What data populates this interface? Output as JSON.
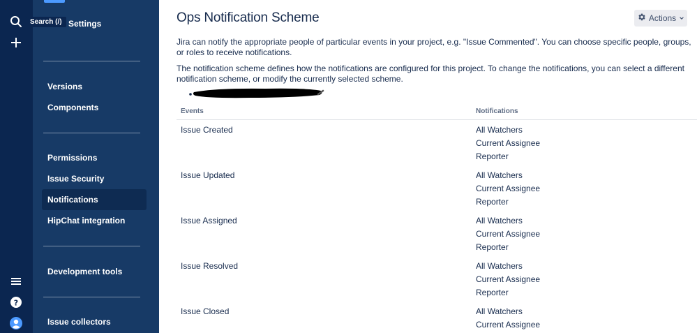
{
  "global_nav": {
    "search_tooltip": "Search (/)"
  },
  "sidebar": {
    "settings_label": "Settings",
    "items": [
      {
        "label": "Versions"
      },
      {
        "label": "Components"
      },
      {
        "label": "Permissions"
      },
      {
        "label": "Issue Security"
      },
      {
        "label": "Notifications",
        "active": true
      },
      {
        "label": "HipChat integration"
      },
      {
        "label": "Development tools"
      },
      {
        "label": "Issue collectors"
      }
    ]
  },
  "page": {
    "title": "Ops Notification Scheme",
    "actions_label": "Actions",
    "description_1": "Jira can notify the appropriate people of particular events in your project, e.g. \"Issue Commented\". You can choose specific people, groups, or roles to receive notifications.",
    "description_2": "The notification scheme defines how the notifications are configured for this project. To change the notifications, you can select a different notification scheme, or modify the currently selected scheme."
  },
  "table": {
    "headers": {
      "events": "Events",
      "notifications": "Notifications"
    },
    "rows": [
      {
        "event": "Issue Created",
        "notifications": [
          "All Watchers",
          "Current Assignee",
          "Reporter"
        ]
      },
      {
        "event": "Issue Updated",
        "notifications": [
          "All Watchers",
          "Current Assignee",
          "Reporter"
        ]
      },
      {
        "event": "Issue Assigned",
        "notifications": [
          "All Watchers",
          "Current Assignee",
          "Reporter"
        ]
      },
      {
        "event": "Issue Resolved",
        "notifications": [
          "All Watchers",
          "Current Assignee",
          "Reporter"
        ]
      },
      {
        "event": "Issue Closed",
        "notifications": [
          "All Watchers",
          "Current Assignee"
        ]
      }
    ]
  },
  "colors": {
    "global_nav": "#0b2650",
    "sidebar": "#173a66",
    "sidebar_active": "#0e2b52"
  }
}
